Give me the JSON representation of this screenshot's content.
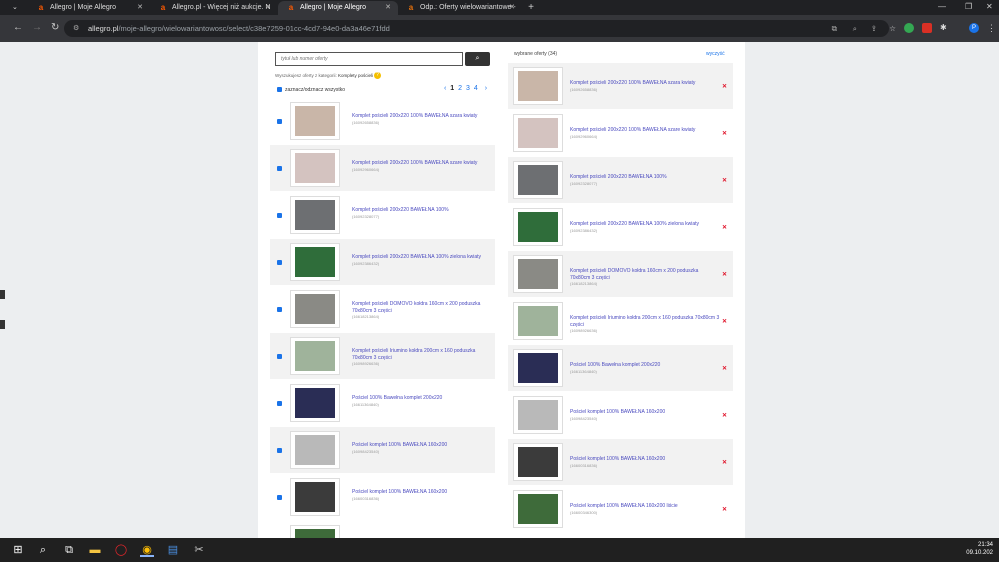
{
  "tabs": [
    {
      "title": "Allegro | Moje Allegro",
      "active": false
    },
    {
      "title": "Allegro.pl - Więcej niż aukcje. N",
      "active": false
    },
    {
      "title": "Allegro | Moje Allegro",
      "active": true
    },
    {
      "title": "Odp.: Oferty wielowariantowe -",
      "active": false
    }
  ],
  "tab_close": "✕",
  "new_tab": "+",
  "address": {
    "domain": "allegro.pl",
    "path": "/moje-allegro/wielowariantowosc/select/c38e7259-01cc-4cd7-94e0-da3a46e71fdd"
  },
  "search": {
    "placeholder": "tytuł lub numer oferty"
  },
  "category": {
    "prefix": "Wyszukujesz oferty z kategorii:",
    "name": "Komplety pościeli"
  },
  "select_all_label": "zaznacz/odznacz wszystko",
  "pagination": {
    "prev": "‹",
    "pages": [
      "1",
      "2",
      "3",
      "4"
    ],
    "current": "1",
    "next": "›"
  },
  "selected": {
    "label": "wybrane oferty (34)",
    "clear": "wyczyść",
    "remove": "✕"
  },
  "left_offers": [
    {
      "title": "Komplet pościeli 200x220 100% BAWEŁNA szara kwiaty",
      "num": "(16092658836)",
      "checked": true,
      "color": "#c9b6a8"
    },
    {
      "title": "Komplet pościeli 200x220 100% BAWEŁNA szare kwiaty",
      "num": "(16092960664)",
      "checked": true,
      "color": "#d4c3c0"
    },
    {
      "title": "Komplet pościeli 200x220 BAWEŁNA 100%",
      "num": "(16092328077)",
      "checked": true,
      "color": "#6d6f72"
    },
    {
      "title": "Komplet pościeli 200x220 BAWEŁNA 100% zielona kwiaty",
      "num": "(16092386432)",
      "checked": true,
      "color": "#2f6d3a"
    },
    {
      "title": "Komplet pościeli DOMOVO kołdra 160cm x 200 poduszka 70x80cm 3 części",
      "num": "(16618213864)",
      "checked": true,
      "color": "#8a8a85"
    },
    {
      "title": "Komplet pościeli Iriumino kołdra 200cm x 160 poduszka 70x80cm 3 części",
      "num": "(16098926636)",
      "checked": true,
      "color": "#9fb39b"
    },
    {
      "title": "Pościel 100% Bawełna komplet 200x220",
      "num": "(16611364840)",
      "checked": true,
      "color": "#2a2d55"
    },
    {
      "title": "Pościel komplet 100% BAWEŁNA 160x200",
      "num": "(16098423540)",
      "checked": true,
      "color": "#b9b9b9"
    },
    {
      "title": "Pościel komplet 100% BAWEŁNA 160x200",
      "num": "(16600316836)",
      "checked": true,
      "color": "#3b3b3b"
    }
  ],
  "right_offers": [
    {
      "title": "Komplet pościeli 200x220 100% BAWEŁNA szara kwiaty",
      "num": "(16092658836)",
      "color": "#c9b6a8"
    },
    {
      "title": "Komplet pościeli 200x220 100% BAWEŁNA szare kwiaty",
      "num": "(16092960664)",
      "color": "#d4c3c0"
    },
    {
      "title": "Komplet pościeli 200x220 BAWEŁNA 100%",
      "num": "(16092328077)",
      "color": "#6d6f72"
    },
    {
      "title": "Komplet pościeli 200x220 BAWEŁNA 100% zielona kwiaty",
      "num": "(16092386432)",
      "color": "#2f6d3a"
    },
    {
      "title": "Komplet pościeli DOMOVO kołdra 160cm x 200 poduszka 70x80cm 3 części",
      "num": "(16618213864)",
      "color": "#8a8a85"
    },
    {
      "title": "Komplet pościeli Iriumino kołdra 200cm x 160 poduszka 70x80cm 3 części",
      "num": "(16098926636)",
      "color": "#9fb39b"
    },
    {
      "title": "Pościel 100% Bawełna komplet 200x220",
      "num": "(16611364840)",
      "color": "#2a2d55"
    },
    {
      "title": "Pościel komplet 100% BAWEŁNA 160x200",
      "num": "(16098423540)",
      "color": "#b9b9b9"
    },
    {
      "title": "Pościel komplet 100% BAWEŁNA 160x200",
      "num": "(16600316836)",
      "color": "#3b3b3b"
    },
    {
      "title": "Pościel komplet 100% BAWEŁNA 160x200 liście",
      "num": "(16600346300)",
      "color": "#3e6b3a"
    }
  ],
  "extensions": [
    "#34a853",
    "#d93025",
    "#ffffff",
    "#1a73e8"
  ],
  "taskbar": {
    "time": "21:34",
    "date": "09.10.202"
  }
}
